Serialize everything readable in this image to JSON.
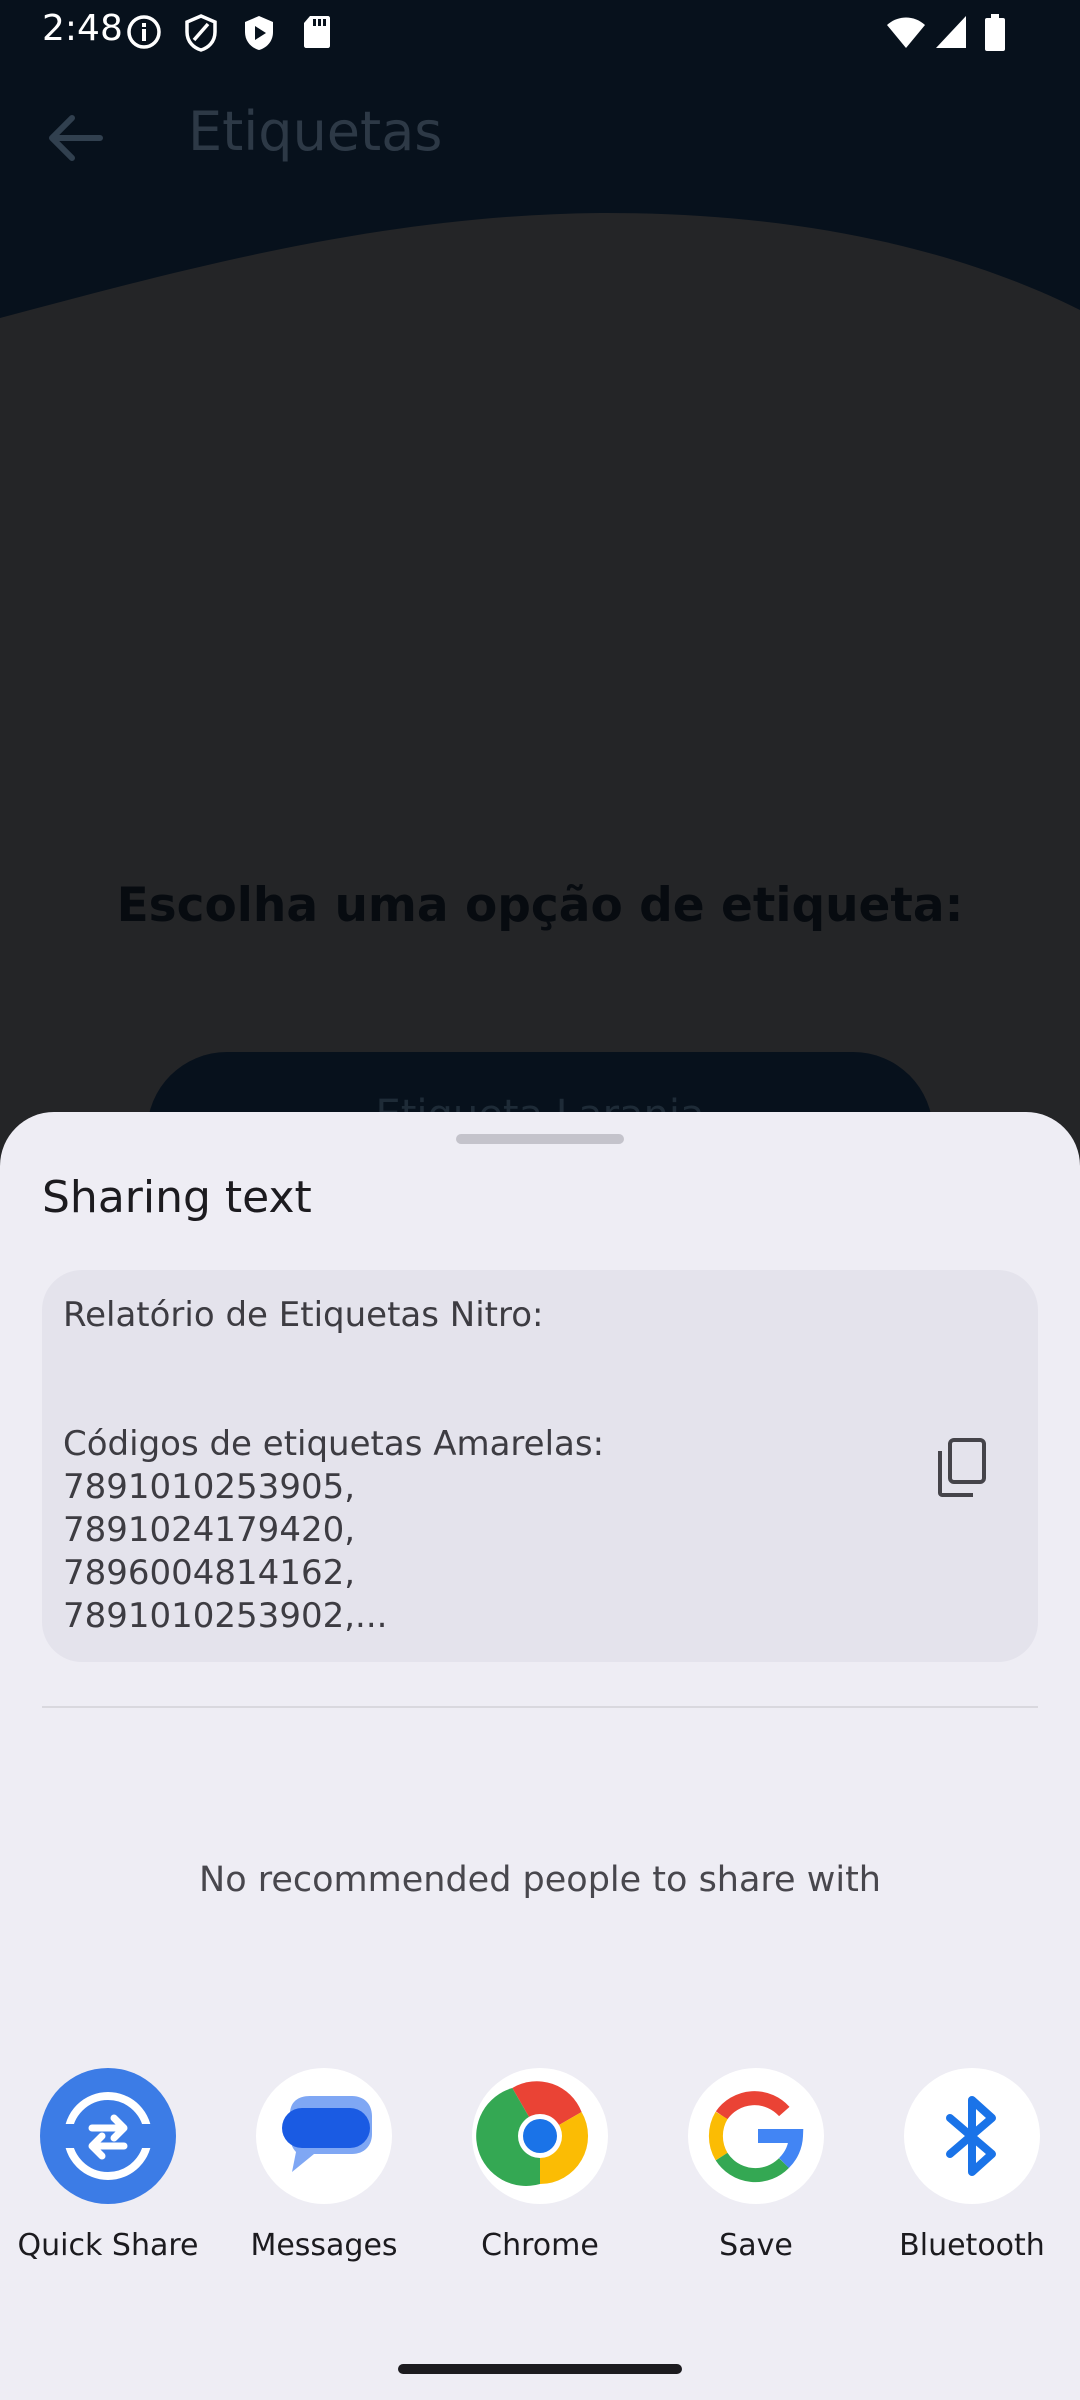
{
  "status_bar": {
    "time": "2:48",
    "icons": [
      "info-icon",
      "shield-icon",
      "play-protect-icon",
      "sd-card-icon",
      "wifi-icon",
      "cellular-signal-icon",
      "battery-icon"
    ]
  },
  "background_app": {
    "title": "Etiquetas",
    "heading": "Escolha uma opção de etiqueta:",
    "button_label": "Etiqueta Laranja"
  },
  "share_sheet": {
    "title": "Sharing text",
    "preview_text": "Relatório de Etiquetas Nitro:\n\n\nCódigos de etiquetas Amarelas:\n7891010253905,\n7891024179420,\n7896004814162,\n7891010253902,...",
    "empty_recommendations": "No recommended people to share with",
    "targets": [
      {
        "label": "Quick Share",
        "icon": "quick-share-icon"
      },
      {
        "label": "Messages",
        "icon": "messages-icon"
      },
      {
        "label": "Chrome",
        "icon": "chrome-icon"
      },
      {
        "label": "Save",
        "icon": "google-icon"
      },
      {
        "label": "Bluetooth",
        "icon": "bluetooth-icon"
      }
    ]
  },
  "colors": {
    "sheet_bg": "#eeedf4",
    "card_bg": "#e4e3ec",
    "quick_share_blue": "#3c7ce6",
    "messages_blue": "#1a5be3",
    "bluetooth_blue": "#1a73e8",
    "app_header": "#07111c"
  }
}
